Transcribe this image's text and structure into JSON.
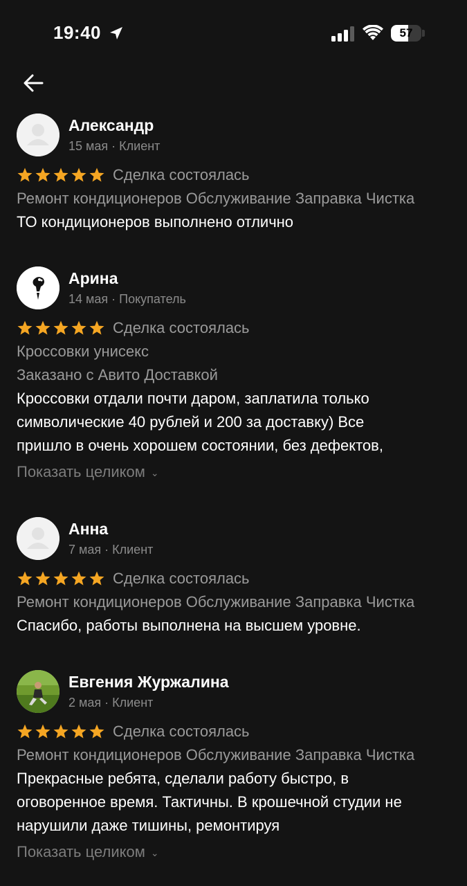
{
  "status_bar": {
    "time": "19:40",
    "battery_level": "57",
    "battery_fraction": 0.57
  },
  "colors": {
    "background": "#141414",
    "star": "#f5a623",
    "muted_text": "#9a9a9a"
  },
  "back_icon": "arrow-left-icon",
  "reviews": [
    {
      "name": "Александр",
      "meta": "15 мая · Клиент",
      "avatar": "placeholder-person",
      "stars": 5,
      "deal_status": "Сделка состоялась",
      "gray_lines": [
        "Ремонт кондиционеров Обслуживание Заправка Чистка"
      ],
      "text_lines": [
        "ТО кондиционеров выполнено отлично"
      ]
    },
    {
      "name": "Арина",
      "meta": "14 мая · Покупатель",
      "avatar": "profile-photo",
      "stars": 5,
      "deal_status": "Сделка состоялась",
      "gray_lines": [
        "Кроссовки унисекс",
        "Заказано с Авито Доставкой"
      ],
      "text_lines": [
        "Кроссовки отдали почти даром, заплатила только",
        "символические 40 рублей и 200 за доставку) Все",
        "пришло в очень хорошем состоянии, без дефектов,"
      ],
      "expand_label": "Показать целиком"
    },
    {
      "name": "Анна",
      "meta": "7 мая · Клиент",
      "avatar": "placeholder-person",
      "stars": 5,
      "deal_status": "Сделка состоялась",
      "gray_lines": [
        "Ремонт кондиционеров Обслуживание Заправка Чистка"
      ],
      "text_lines": [
        "Спасибо, работы выполнена на высшем уровне."
      ]
    },
    {
      "name": "Евгения Журжалина",
      "meta": "2 мая · Клиент",
      "avatar": "profile-photo",
      "stars": 5,
      "deal_status": "Сделка состоялась",
      "gray_lines": [
        "Ремонт кондиционеров Обслуживание Заправка Чистка"
      ],
      "text_lines": [
        "Прекрасные ребята, сделали работу быстро, в",
        "оговоренное время. Тактичны. В крошечной студии не",
        "нарушили даже тишины, ремонтируя"
      ],
      "expand_label": "Показать целиком"
    }
  ]
}
